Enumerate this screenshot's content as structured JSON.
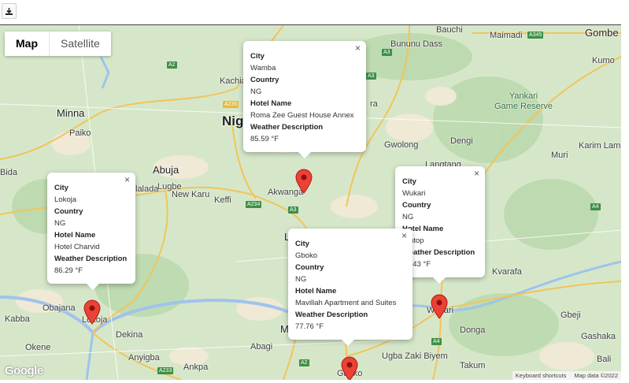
{
  "toolbar": {
    "download_icon": "download-icon"
  },
  "map": {
    "type_control": {
      "map_label": "Map",
      "satellite_label": "Satellite"
    },
    "attribution": {
      "logo": "Google",
      "shortcuts": "Keyboard shortcuts",
      "data": "Map data ©2022"
    },
    "places": {
      "minna": "Minna",
      "paiko": "Paiko",
      "abuja": "Abuja",
      "lugbe": "Lugbe",
      "new_karu": "New Karu",
      "keffi": "Keffi",
      "bida": "Bida",
      "lalada": "lalada",
      "kachia": "Kachia",
      "nig": "Nig",
      "akwanga": "Akwanga",
      "bauchi": "Bauchi",
      "maimadi": "Maimadi",
      "gombe": "Gombe",
      "bununu_dass": "Bununu Dass",
      "kumo": "Kumo",
      "gwolong": "Gwolong",
      "dengi": "Dengi",
      "muri": "Muri",
      "karim_lamido": "Karim Lamid",
      "langtang": "Langtang",
      "kvarafa": "Kvarafa",
      "obajana": "Obajana",
      "kabba": "Kabba",
      "okene": "Okene",
      "dekina": "Dekina",
      "anyigba": "Anyigba",
      "ankpa": "Ankpa",
      "abagi": "Abagi",
      "ugba": "Ugba Zaki Biyem",
      "donga": "Donga",
      "gbeji": "Gbeji",
      "gashaka": "Gashaka",
      "takum": "Takum",
      "bali": "Bali",
      "ma": "Ma",
      "lo": "L",
      "ra": "ra",
      "gboko_map": "Gboko",
      "lokoja_map": "Lokoja",
      "wukari_map": "Wukari",
      "yankari": "Yankari\nGame Reserve"
    },
    "roads": [
      "A3",
      "A345",
      "A3",
      "A235",
      "A2",
      "A234",
      "A3",
      "A4",
      "A4",
      "A233",
      "A4",
      "A2"
    ],
    "markers": [
      {
        "name": "Wamba",
        "country": "NG",
        "hotel": "Roma Zee Guest House Annex",
        "weather": "85.59 °F"
      },
      {
        "name": "Lokoja",
        "country": "NG",
        "hotel": "Hotel Charvid",
        "weather": "86.29 °F"
      },
      {
        "name": "Wukari",
        "country": "NG",
        "hotel": "Amtop",
        "weather": "89.43 °F"
      },
      {
        "name": "Gboko",
        "country": "NG",
        "hotel": "Mavillah Apartment and Suites",
        "weather": "77.76 °F"
      }
    ],
    "field_labels": {
      "city": "City",
      "country": "Country",
      "hotel": "Hotel Name",
      "weather": "Weather Description"
    },
    "close_glyph": "×"
  }
}
